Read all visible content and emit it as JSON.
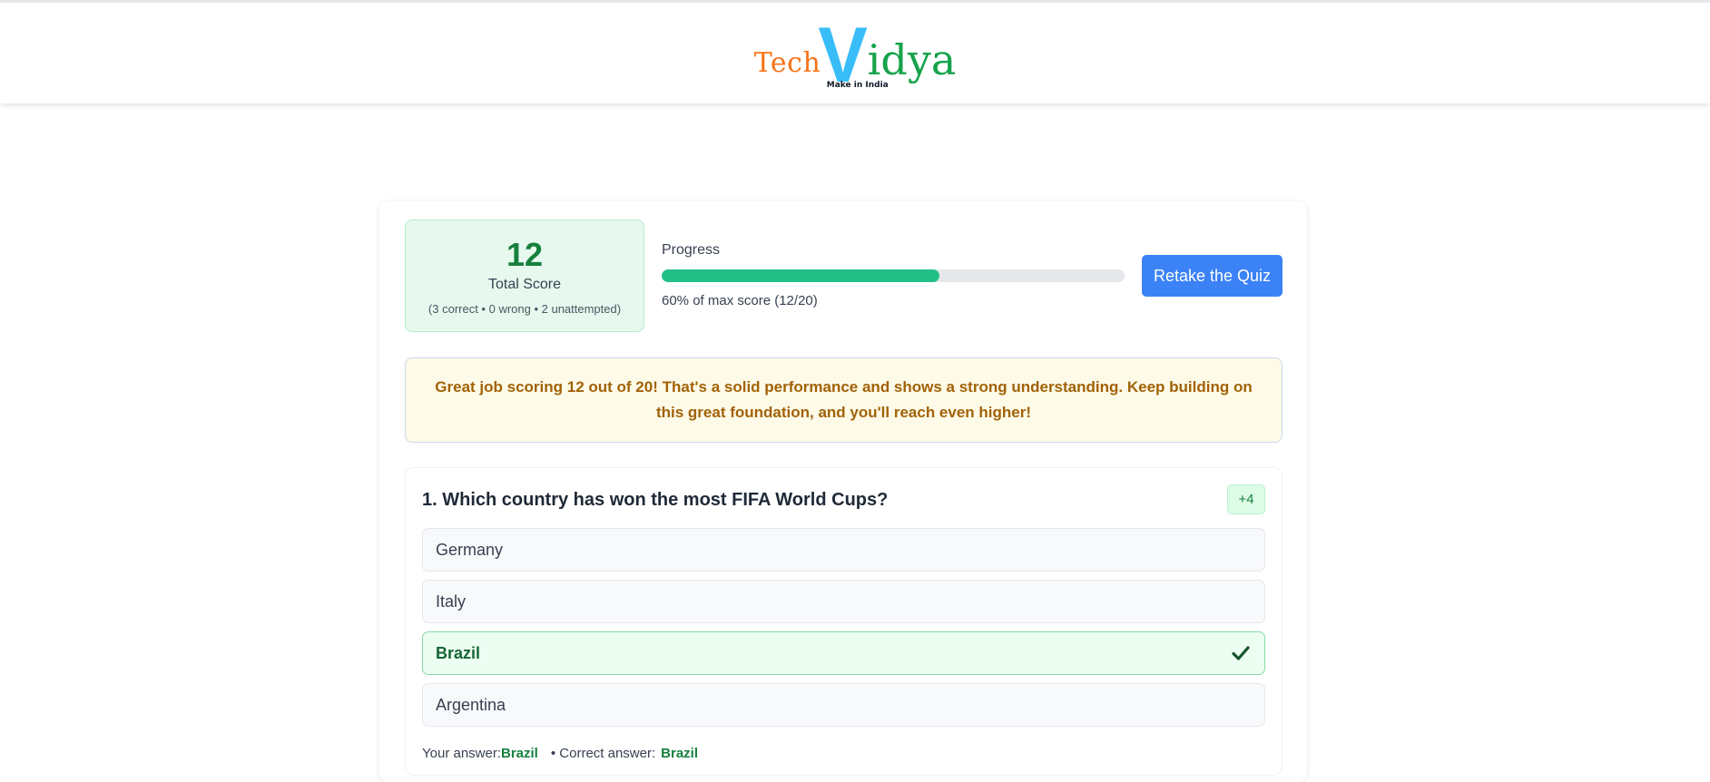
{
  "header": {
    "logo": {
      "part1": "Tech",
      "part2": "V",
      "part3": "idya",
      "tagline": "Make in India"
    }
  },
  "summary": {
    "score_value": "12",
    "score_label": "Total Score",
    "score_detail": "(3 correct • 0 wrong • 2 unattempted)",
    "progress_label": "Progress",
    "progress_fraction": 0.6,
    "progress_text": "60% of max score (12/20)",
    "retake_label": "Retake the Quiz"
  },
  "feedback": {
    "message": "Great job scoring 12 out of 20! That's a solid performance and shows a strong understanding. Keep building on this great foundation, and you'll reach even higher!"
  },
  "question": {
    "title": "1. Which country has won the most FIFA World Cups?",
    "points": "+4",
    "options": [
      {
        "label": "Germany"
      },
      {
        "label": "Italy"
      },
      {
        "label": "Brazil"
      },
      {
        "label": "Argentina"
      }
    ],
    "your_answer_label": "Your answer:",
    "your_answer_value": "Brazil",
    "correct_answer_label": "• Correct answer:",
    "correct_answer_value": "Brazil"
  },
  "colors": {
    "accent_blue": "#3b82f6",
    "success_green": "#15803d",
    "progress_green": "#22c087",
    "feedback_text": "#a16207"
  },
  "icons": {
    "correct_option": "check-icon"
  }
}
